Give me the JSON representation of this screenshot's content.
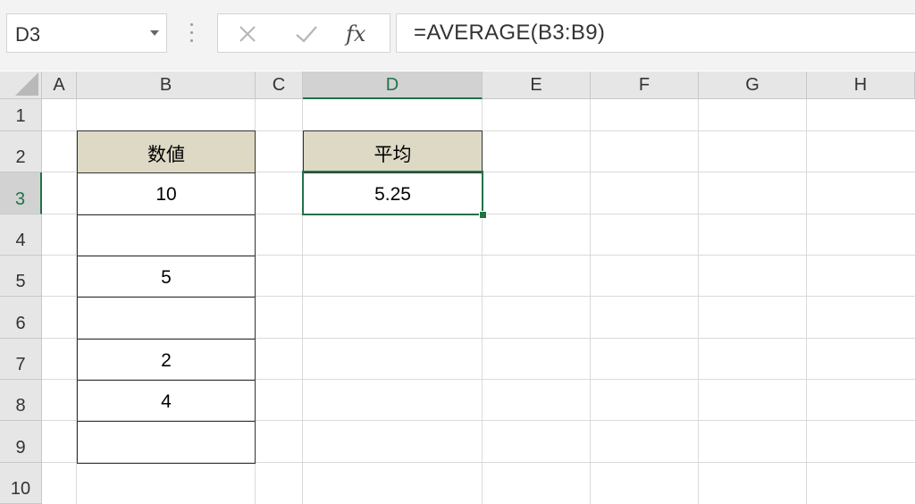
{
  "formula_bar": {
    "name_box": "D3",
    "formula": "=AVERAGE(B3:B9)",
    "fx_label": "fx",
    "icons": [
      "chevron-down-icon",
      "cancel-icon",
      "enter-icon",
      "function-icon"
    ]
  },
  "columns": [
    "A",
    "B",
    "C",
    "D",
    "E",
    "F",
    "G",
    "H"
  ],
  "rows": [
    "1",
    "2",
    "3",
    "4",
    "5",
    "6",
    "7",
    "8",
    "9",
    "10"
  ],
  "selected": {
    "column": "D",
    "row": "3"
  },
  "table_b": {
    "header": "数値",
    "values": [
      "10",
      "",
      "5",
      "",
      "2",
      "4",
      ""
    ]
  },
  "table_d": {
    "header": "平均",
    "value": "5.25"
  },
  "colors": {
    "accent": "#217346",
    "header_fill": "#ddd9c4",
    "grid": "#dadada"
  }
}
